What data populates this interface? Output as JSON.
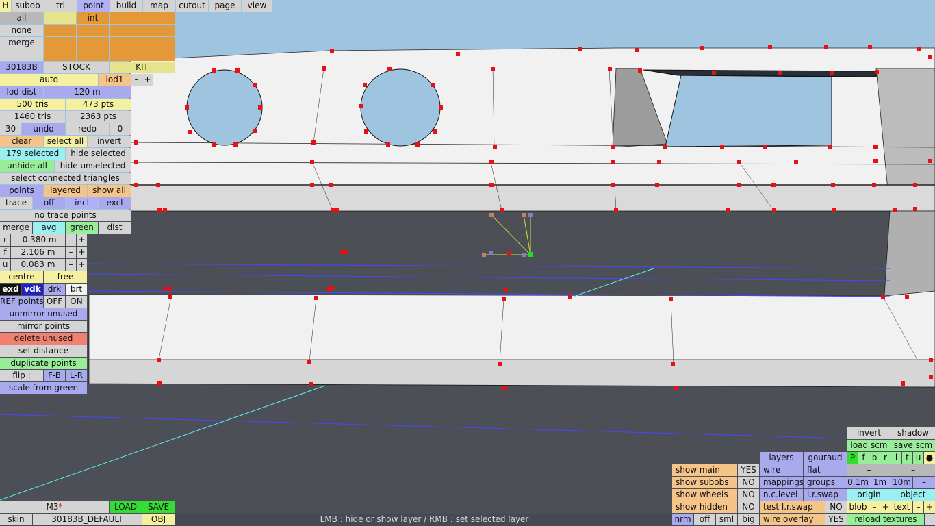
{
  "tabs": {
    "h": "H",
    "subob": "subob",
    "tri": "tri",
    "point": "point",
    "build": "build",
    "map": "map",
    "cutout": "cutout",
    "page": "page",
    "view": "view"
  },
  "select_rows": {
    "all": "all",
    "int": "int",
    "none": "none",
    "merge": "merge",
    "minus": "–"
  },
  "model": {
    "id": "30183B",
    "stock": "STOCK",
    "kit": "KIT"
  },
  "lod": {
    "auto": "auto",
    "lod1": "lod1",
    "minus": "–",
    "plus": "+",
    "dist_label": "lod dist",
    "dist_value": "120 m"
  },
  "stats": {
    "tris_a": "500 tris",
    "pts_a": "473 pts",
    "tris_b": "1460 tris",
    "pts_b": "2363 pts"
  },
  "history": {
    "count": "30",
    "undo": "undo",
    "redo": "redo",
    "redo_count": "0"
  },
  "selection": {
    "clear": "clear",
    "select_all": "select all",
    "invert": "invert",
    "selected_count": "179 selected",
    "hide_selected": "hide selected",
    "unhide_all": "unhide all",
    "hide_unselected": "hide unselected",
    "select_connected": "select connected triangles"
  },
  "points_row": {
    "points": "points",
    "layered": "layered",
    "show_all": "show all"
  },
  "trace": {
    "label": "trace",
    "off": "off",
    "incl": "incl",
    "excl": "excl",
    "none": "no trace points"
  },
  "merge_row": {
    "merge": "merge",
    "avg": "avg",
    "green": "green",
    "dist": "dist"
  },
  "coords": [
    {
      "axis": "r",
      "value": "-0.380 m"
    },
    {
      "axis": "f",
      "value": "2.106 m"
    },
    {
      "axis": "u",
      "value": "0.083 m"
    }
  ],
  "step": {
    "minus": "–",
    "plus": "+"
  },
  "centre": {
    "centre": "centre",
    "free": "free"
  },
  "brightness": {
    "exd": "exd",
    "vdk": "vdk",
    "drk": "drk",
    "brt": "brt"
  },
  "ref": {
    "label": "REF points",
    "off": "OFF",
    "on": "ON"
  },
  "actions": {
    "unmirror": "unmirror unused",
    "mirror": "mirror points",
    "delete": "delete unused",
    "set_distance": "set distance",
    "duplicate": "duplicate points",
    "flip": "flip :",
    "fb": "F-B",
    "lr": "L-R",
    "scale": "scale from green"
  },
  "bottom_left": {
    "m3": "M3",
    "load": "LOAD",
    "save": "SAVE",
    "skin": "skin",
    "skin_name": "30183B_DEFAULT",
    "obj": "OBJ"
  },
  "status_text": "LMB : hide or show layer / RMB : set selected layer",
  "right_panel": {
    "invert": "invert",
    "shadow": "shadow",
    "load_scm": "load scm",
    "save_scm": "save scm",
    "layers": "layers",
    "gouraud": "gouraud",
    "wire": "wire",
    "flat": "flat",
    "mappings": "mappings",
    "groups": "groups",
    "nclevel": "n.c.level",
    "lrswap": "l.r.swap",
    "test_lrswap": "test l.r.swap",
    "wire_overlay": "wire overlay",
    "letters": [
      "P",
      "f",
      "b",
      "r",
      "l",
      "t",
      "u",
      "●"
    ],
    "dash": "–",
    "m01": "0.1m",
    "m1": "1m",
    "m10": "10m",
    "origin": "origin",
    "object": "object",
    "blob": "blob",
    "text": "text",
    "plus": "+",
    "minus": "–",
    "reload": "reload textures",
    "no": "NO",
    "yes": "YES",
    "show_main": "show main",
    "show_subobs": "show subobs",
    "show_wheels": "show wheels",
    "show_hidden": "show hidden",
    "nrm": "nrm",
    "off": "off",
    "sml": "sml",
    "big": "big"
  },
  "colors": {
    "sky": "#9fc4e0",
    "floor": "#4c4f56",
    "body": "#f1f1f1",
    "accent_red": "#e81010",
    "selected_tab": "#a9a9ee"
  }
}
